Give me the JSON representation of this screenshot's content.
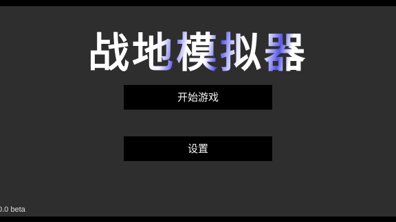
{
  "menu": {
    "title": "战地模拟器",
    "start_label": "开始游戏",
    "settings_label": "设置"
  },
  "footer": {
    "version": "0.0 beta"
  },
  "colors": {
    "background": "#2e2e2e",
    "letterbox": "#000000",
    "button_background": "#000000",
    "button_text": "#f4f4f4",
    "title_text": "#ffffff",
    "title_accent": "#4a4ae8"
  }
}
